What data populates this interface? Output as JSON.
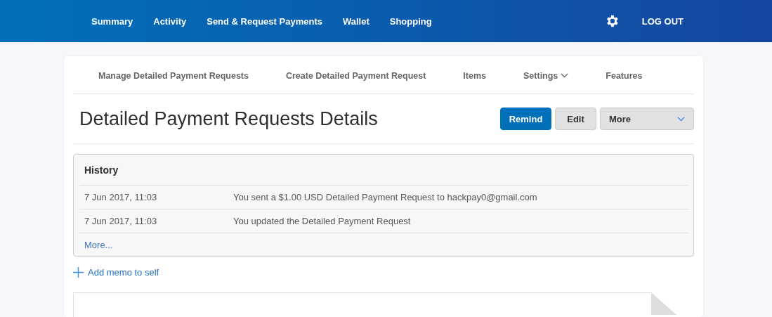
{
  "top_nav": {
    "items": [
      {
        "label": "Summary"
      },
      {
        "label": "Activity"
      },
      {
        "label": "Send & Request Payments"
      },
      {
        "label": "Wallet"
      },
      {
        "label": "Shopping"
      }
    ],
    "logout": "LOG OUT"
  },
  "sub_nav": {
    "items": [
      {
        "label": "Manage Detailed Payment Requests",
        "kind": "link"
      },
      {
        "label": "Create Detailed Payment Request",
        "kind": "link"
      },
      {
        "label": "Items",
        "kind": "link"
      },
      {
        "label": "Settings",
        "kind": "dropdown"
      },
      {
        "label": "Features",
        "kind": "link"
      }
    ]
  },
  "page_title": "Detailed Payment Requests Details",
  "actions": {
    "remind": "Remind",
    "edit": "Edit",
    "more": "More"
  },
  "history": {
    "title": "History",
    "rows": [
      {
        "date": "7 Jun 2017, 11:03",
        "text": "You sent a $1.00 USD Detailed Payment Request to hackpay0@gmail.com"
      },
      {
        "date": "7 Jun 2017, 11:03",
        "text": "You updated the Detailed Payment Request"
      }
    ],
    "more_link": "More..."
  },
  "memo_link": "Add memo to self"
}
